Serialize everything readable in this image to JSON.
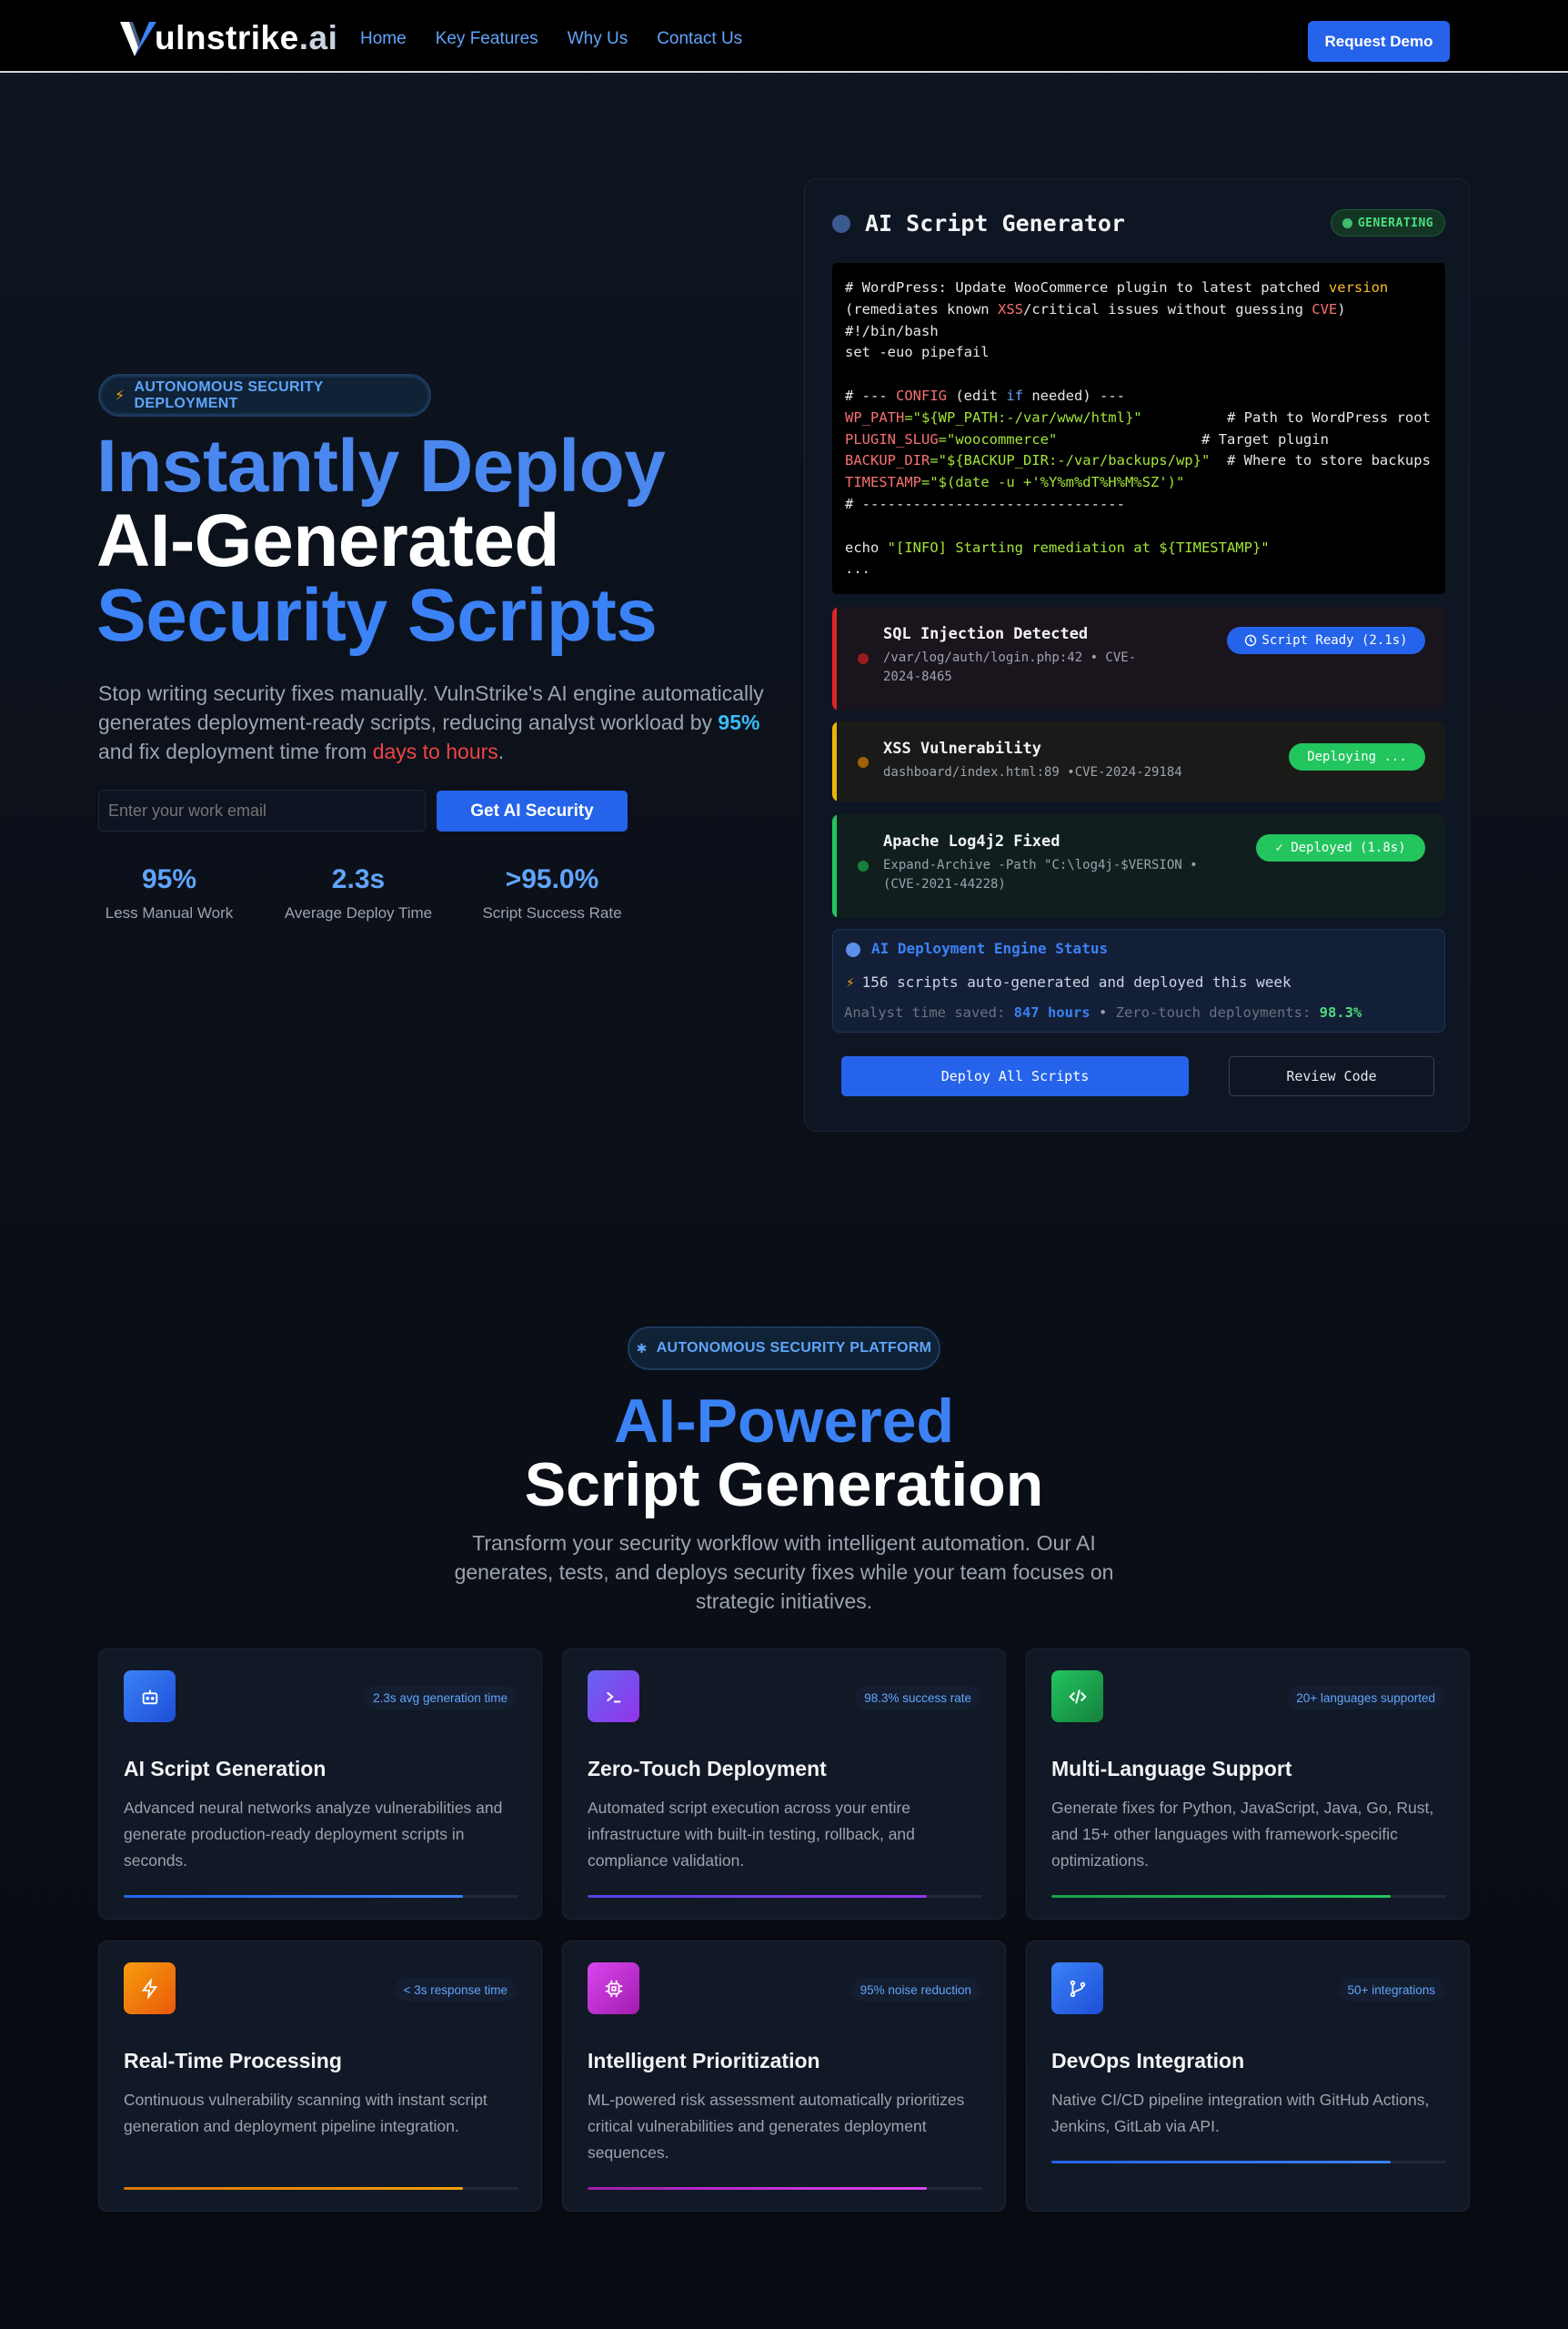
{
  "nav": {
    "logo_main": "ulnstrike",
    "logo_suffix": ".ai",
    "links": [
      "Home",
      "Key Features",
      "Why Us",
      "Contact Us"
    ],
    "cta": "Request Demo"
  },
  "hero": {
    "badge": "AUTONOMOUS SECURITY DEPLOYMENT",
    "title_line1": "Instantly Deploy",
    "title_line2": "AI-Generated",
    "title_line3": "Security Scripts",
    "sub_part1": "Stop writing security fixes manually. VulnStrike's AI engine automatically generates deployment-ready scripts, reducing analyst workload by ",
    "sub_highlight1": "95%",
    "sub_part2": " and fix deployment time from ",
    "sub_highlight2": "days to hours",
    "sub_part3": ".",
    "email_placeholder": "Enter your work email",
    "cta": "Get AI Security",
    "stats": [
      {
        "value": "95%",
        "label": "Less Manual Work"
      },
      {
        "value": "2.3s",
        "label": "Average Deploy Time"
      },
      {
        "value": ">95.0%",
        "label": "Script Success Rate"
      }
    ]
  },
  "panel": {
    "title": "AI Script Generator",
    "status": "GENERATING",
    "code": {
      "l1a": "# WordPress: Update WooCommerce plugin to latest patched ",
      "l1b": "version",
      "l2a": "(remediates known ",
      "l2b": "XSS",
      "l2c": "/critical issues without guessing ",
      "l2d": "CVE",
      "l2e": ")",
      "l3": "#!/bin/bash",
      "l4": "set -euo pipefail",
      "l6a": "# --- ",
      "l6b": "CONFIG",
      "l6c": " (edit ",
      "l6d": "if",
      "l6e": " needed) ---",
      "l7a": "WP_PATH",
      "l7b": "=\"${WP_PATH:-/var/www/html}\"",
      "l7c": "          # Path to WordPress root",
      "l8a": "PLUGIN_SLUG",
      "l8b": "=\"woocommerce\"",
      "l8c": "                 # Target plugin",
      "l9a": "BACKUP_DIR",
      "l9b": "=\"${BACKUP_DIR:-/var/backups/wp}\"",
      "l9c": "  # Where to store backups",
      "l10a": "TIMESTAMP",
      "l10b": "=\"$(date -u +'%Y%m%dT%H%M%SZ')\"",
      "l11": "# -------------------------------",
      "l13a": "echo ",
      "l13b": "\"[INFO] Starting remediation at ${TIMESTAMP}\"",
      "l14": "..."
    },
    "alerts": [
      {
        "title": "SQL Injection Detected",
        "detail": "/var/log/auth/login.php:42 • CVE-2024-8465",
        "status": "Script Ready (2.1s)"
      },
      {
        "title": "XSS Vulnerability",
        "detail": "dashboard/index.html:89 •CVE-2024-29184",
        "status": "Deploying ..."
      },
      {
        "title": "Apache Log4j2 Fixed",
        "detail": "Expand-Archive -Path \"C:\\log4j-$VERSION • (CVE-2021-44228)",
        "status": "✓ Deployed (1.8s)"
      }
    ],
    "engine": {
      "title": "AI Deployment Engine Status",
      "line": "156 scripts auto-generated and deployed this week",
      "saved_label": "Analyst time saved: ",
      "saved_value": "847 hours",
      "sep": " • ",
      "zero_label": "Zero-touch deployments: ",
      "zero_value": "98.3%"
    },
    "deploy_btn": "Deploy All Scripts",
    "review_btn": "Review Code"
  },
  "features": {
    "badge": "AUTONOMOUS SECURITY PLATFORM",
    "title_line1": "AI-Powered",
    "title_line2": "Script Generation",
    "sub": "Transform your security workflow with intelligent automation. Our AI generates, tests, and deploys security fixes while your team focuses on strategic initiatives.",
    "cards": [
      {
        "title": "AI Script Generation",
        "tag": "2.3s avg generation time",
        "desc": "Advanced neural networks analyze vulnerabilities and generate production-ready deployment scripts in seconds.",
        "icon": "robot-icon",
        "color": "#2563eb",
        "progress": 0.86
      },
      {
        "title": "Zero-Touch Deployment",
        "tag": "98.3% success rate",
        "desc": "Automated script execution across your entire infrastructure with built-in testing, rollback, and compliance validation.",
        "icon": "terminal-icon",
        "color": "#7c3aed",
        "progress": 0.86
      },
      {
        "title": "Multi-Language Support",
        "tag": "20+ languages supported",
        "desc": "Generate fixes for Python, JavaScript, Java, Go, Rust, and 15+ other languages with framework-specific optimizations.",
        "icon": "code-icon",
        "color": "#16a34a",
        "progress": 0.86
      },
      {
        "title": "Real-Time Processing",
        "tag": "< 3s response time",
        "desc": "Continuous vulnerability scanning with instant script generation and deployment pipeline integration.",
        "icon": "lightning-icon",
        "color": "#f59e0b",
        "progress": 0.86
      },
      {
        "title": "Intelligent Prioritization",
        "tag": "95% noise reduction",
        "desc": "ML-powered risk assessment automatically prioritizes critical vulnerabilities and generates deployment sequences.",
        "icon": "chip-icon",
        "color": "#c026d3",
        "progress": 0.86
      },
      {
        "title": "DevOps Integration",
        "tag": "50+ integrations",
        "desc": "Native CI/CD pipeline integration with GitHub Actions, Jenkins, GitLab via API.",
        "icon": "git-branch-icon",
        "color": "#2563eb",
        "progress": 0.86
      }
    ]
  }
}
